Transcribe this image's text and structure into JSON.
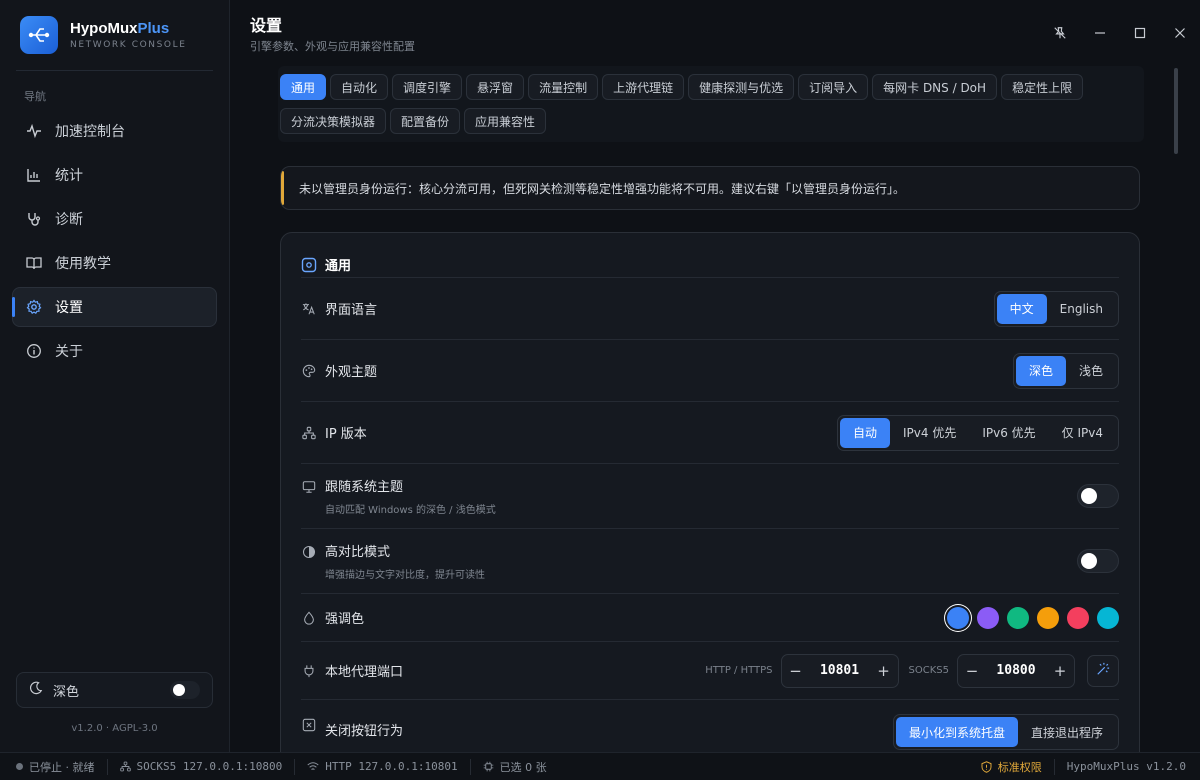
{
  "brand": {
    "name_main": "HypoMux",
    "name_accent": "Plus",
    "subtitle": "NETWORK CONSOLE"
  },
  "sidebar": {
    "nav_heading": "导航",
    "items": [
      {
        "label": "加速控制台",
        "icon": "pulse-icon"
      },
      {
        "label": "统计",
        "icon": "bar-chart-icon"
      },
      {
        "label": "诊断",
        "icon": "stethoscope-icon"
      },
      {
        "label": "使用教学",
        "icon": "book-icon"
      },
      {
        "label": "设置",
        "icon": "gear-icon",
        "active": true
      },
      {
        "label": "关于",
        "icon": "info-icon"
      }
    ],
    "theme_label": "深色",
    "version": "v1.2.0 · AGPL-3.0"
  },
  "header": {
    "title": "设置",
    "subtitle": "引擎参数、外观与应用兼容性配置"
  },
  "tabs": [
    "通用",
    "自动化",
    "调度引擎",
    "悬浮窗",
    "流量控制",
    "上游代理链",
    "健康探测与优选",
    "订阅导入",
    "每网卡 DNS / DoH",
    "稳定性上限",
    "分流决策模拟器",
    "配置备份",
    "应用兼容性"
  ],
  "notice": "未以管理员身份运行：核心分流可用，但死网关检测等稳定性增强功能将不可用。建议右键「以管理员身份运行」。",
  "general": {
    "heading": "通用",
    "language": {
      "label": "界面语言",
      "options": [
        "中文",
        "English"
      ],
      "selected": "中文"
    },
    "theme": {
      "label": "外观主题",
      "options": [
        "深色",
        "浅色"
      ],
      "selected": "深色"
    },
    "ip_version": {
      "label": "IP 版本",
      "options": [
        "自动",
        "IPv4 优先",
        "IPv6 优先",
        "仅 IPv4"
      ],
      "selected": "自动"
    },
    "follow_system": {
      "label": "跟随系统主题",
      "desc": "自动匹配 Windows 的深色 / 浅色模式",
      "on": false
    },
    "high_contrast": {
      "label": "高对比模式",
      "desc": "增强描边与文字对比度，提升可读性",
      "on": false
    },
    "accent": {
      "label": "强调色",
      "colors": [
        "#3b82f6",
        "#8b5cf6",
        "#10b981",
        "#f59e0b",
        "#f43f5e",
        "#06b6d4"
      ],
      "selected": "#3b82f6"
    },
    "proxy_port": {
      "label": "本地代理端口",
      "http_label": "HTTP / HTTPS",
      "http_value": "10801",
      "socks_label": "SOCKS5",
      "socks_value": "10800"
    },
    "close_behavior": {
      "label": "关闭按钮行为",
      "options": [
        "最小化到系统托盘",
        "直接退出程序"
      ],
      "selected": "最小化到系统托盘"
    }
  },
  "statusbar": {
    "state": "已停止 · 就绪",
    "socks": "SOCKS5 127.0.0.1:10800",
    "http": "HTTP 127.0.0.1:10801",
    "selected": "已选 0 张",
    "permission": "标准权限",
    "app_version": "HypoMuxPlus v1.2.0"
  }
}
